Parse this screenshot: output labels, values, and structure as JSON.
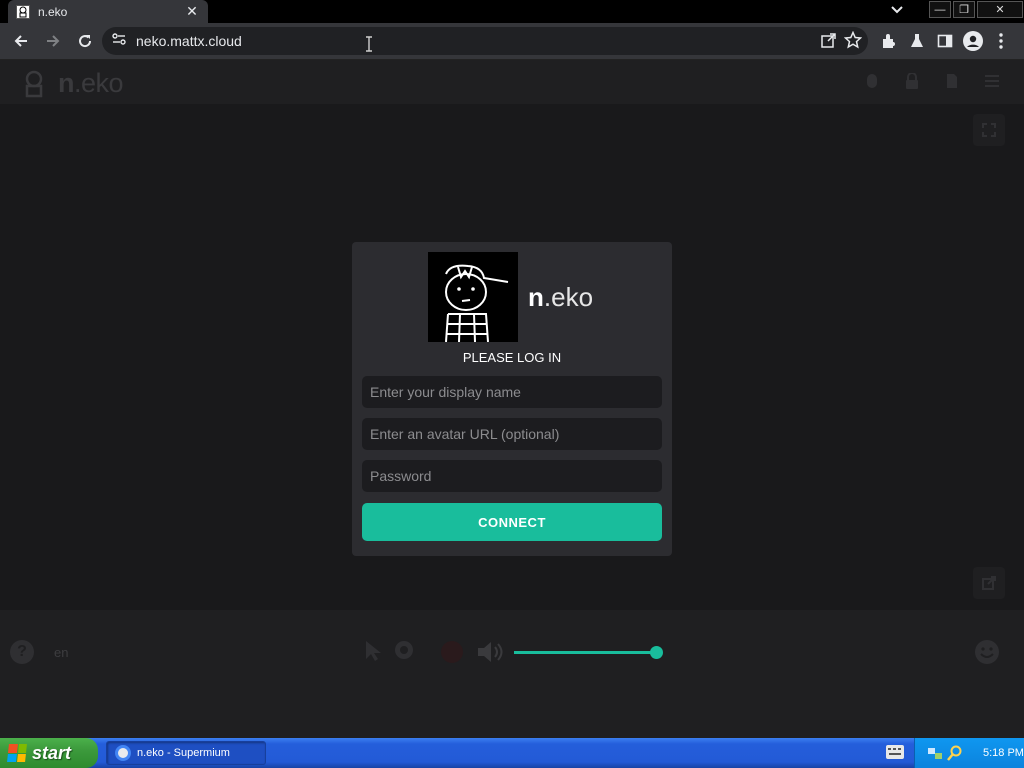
{
  "browser": {
    "tab_title": "n.eko",
    "tab_close": "✕",
    "url": "neko.mattx.cloud",
    "window_controls": {
      "minimize": "—",
      "restore": "❐",
      "close": "✕"
    }
  },
  "app": {
    "logo_bold": "n",
    "logo_rest": ".eko",
    "lang": "en",
    "help_label": "?"
  },
  "login": {
    "logo_bold": "n",
    "logo_rest": ".eko",
    "heading": "PLEASE LOG IN",
    "display_name_placeholder": "Enter your display name",
    "avatar_placeholder": "Enter an avatar URL (optional)",
    "password_placeholder": "Password",
    "connect_label": "CONNECT"
  },
  "volume": {
    "level_percent": 100
  },
  "taskbar": {
    "start_label": "start",
    "task_label": "n.eko - Supermium",
    "clock": "5:18 PM"
  },
  "colors": {
    "accent": "#19bd9c",
    "page_background": "#19191b",
    "card_background": "#2c2c30",
    "taskbar_blue": "#245edb"
  }
}
